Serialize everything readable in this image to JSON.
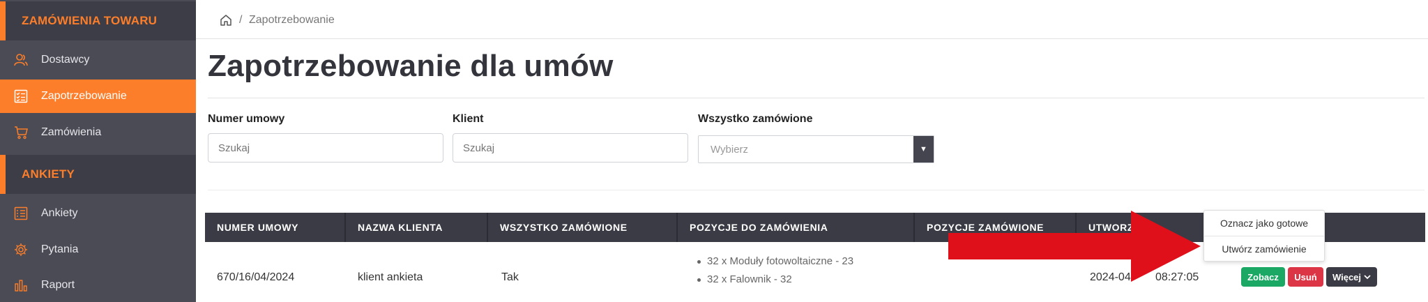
{
  "sidebar": {
    "sections": [
      {
        "label": "ZAMÓWIENIA TOWARU"
      },
      {
        "label": "ANKIETY"
      }
    ],
    "items": [
      {
        "label": "Dostawcy",
        "icon": "users-icon"
      },
      {
        "label": "Zapotrzebowanie",
        "icon": "checklist-icon",
        "active": true
      },
      {
        "label": "Zamówienia",
        "icon": "cart-icon"
      },
      {
        "label": "Ankiety",
        "icon": "list-icon"
      },
      {
        "label": "Pytania",
        "icon": "gear-icon"
      },
      {
        "label": "Raport",
        "icon": "chart-icon"
      }
    ]
  },
  "breadcrumb": {
    "separator": "/",
    "current": "Zapotrzebowanie"
  },
  "page_title": "Zapotrzebowanie dla umów",
  "filters": {
    "contract_number": {
      "label": "Numer umowy",
      "placeholder": "Szukaj"
    },
    "client": {
      "label": "Klient",
      "placeholder": "Szukaj"
    },
    "all_ordered": {
      "label": "Wszystko zamówione",
      "placeholder": "Wybierz"
    }
  },
  "table": {
    "columns": [
      "NUMER UMOWY",
      "NAZWA KLIENTA",
      "WSZYSTKO ZAMÓWIONE",
      "POZYCJE DO ZAMÓWIENIA",
      "POZYCJE ZAMÓWIONE",
      "UTWORZO"
    ],
    "rows": [
      {
        "contract_number": "670/16/04/2024",
        "client": "klient ankieta",
        "all_ordered": "Tak",
        "positions_to_order": [
          "32 x Moduły fotowoltaiczne - 23",
          "32 x Falownik - 32"
        ],
        "positions_ordered": "",
        "created_start": "2024-04-",
        "created_end": "08:27:05"
      }
    ]
  },
  "dropdown": {
    "items": [
      "Oznacz jako gotowe",
      "Utwórz zamówienie"
    ]
  },
  "actions": {
    "view": "Zobacz",
    "delete": "Usuń",
    "more": "Więcej"
  },
  "colors": {
    "accent": "#fd7e2a",
    "sidebar": "#4a4b55",
    "table_header": "#3a3b44",
    "success": "#1aa864",
    "danger": "#dc3545",
    "arrow": "#e0101a"
  }
}
